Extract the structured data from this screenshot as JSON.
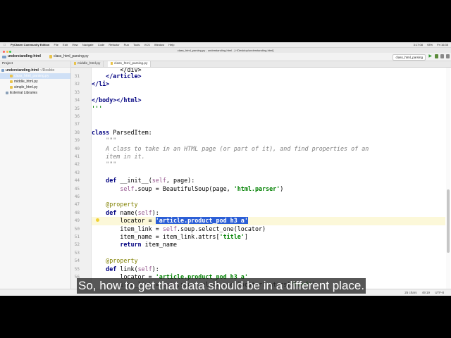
{
  "menubar": {
    "apple_icon": "apple-icon",
    "items": [
      "PyCharm Community Edition",
      "File",
      "Edit",
      "View",
      "Navigate",
      "Code",
      "Refactor",
      "Run",
      "Tools",
      "VCS",
      "Window",
      "Help"
    ],
    "status": [
      "3:17:08",
      "93%",
      "Fri 16:35"
    ]
  },
  "window": {
    "title": "class_html_parsing.py - understanding-html - [~/Desktop/understanding-html]"
  },
  "toolbar": {
    "project_name": "understanding-html",
    "file_name": "class_html_parsing.py",
    "run_config": "class_html_parsing"
  },
  "project": {
    "header": "Project",
    "tree": [
      {
        "label": "understanding-html",
        "path": "~/Deskto",
        "type": "folder"
      },
      {
        "label": "class_html_parsing.py",
        "type": "py"
      },
      {
        "label": "middle_html.py",
        "type": "py"
      },
      {
        "label": "simple_html.py",
        "type": "py"
      },
      {
        "label": "External Libraries",
        "type": "lib"
      }
    ]
  },
  "tabs": [
    "middle_html.py",
    "class_html_parsing.py"
  ],
  "editor": {
    "line_numbers": [
      "31",
      "32",
      "33",
      "34",
      "35",
      "36",
      "37",
      "38",
      "39",
      "40",
      "41",
      "42",
      "43",
      "44",
      "45",
      "46",
      "47",
      "48",
      "49",
      "50",
      "51",
      "52",
      "53",
      "54",
      "55",
      "56"
    ],
    "selected_locator": "'article.product_pod h3 a'"
  },
  "statusbar": {
    "chars": "25 chars",
    "position": "49:19",
    "encoding": "UTF-8"
  },
  "caption": "So, how to get that data should be in a different place."
}
